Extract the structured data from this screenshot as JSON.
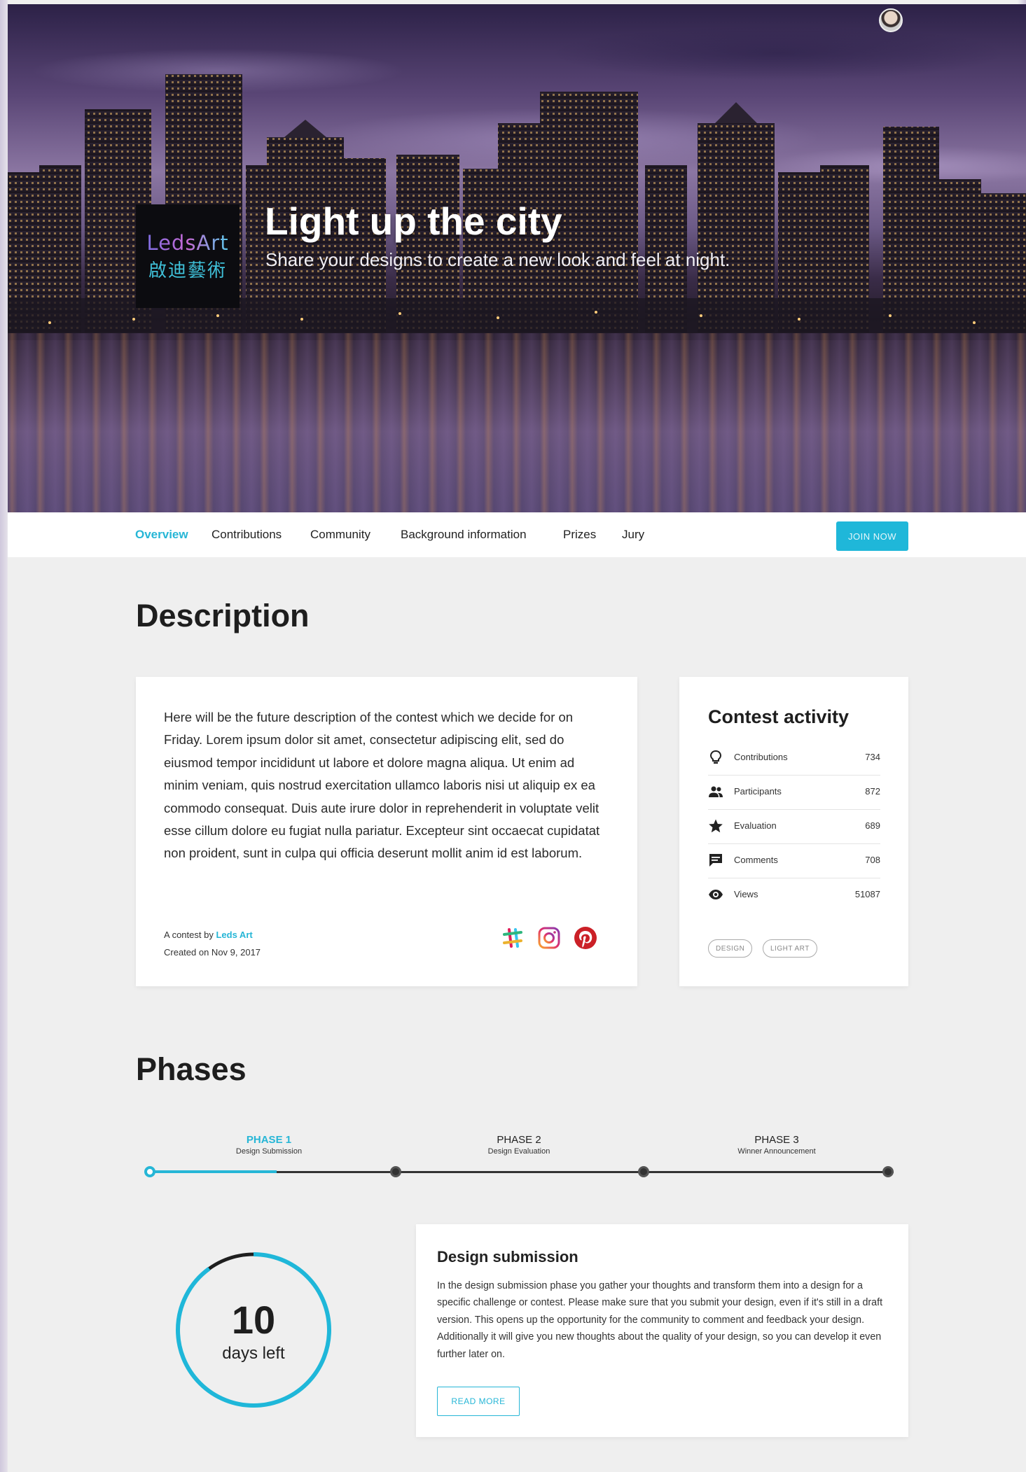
{
  "hero": {
    "title": "Light up the city",
    "subtitle": "Share your designs to create a new look and feel at night.",
    "logo_line1": "LedsArt",
    "logo_line2": "啟迪藝術"
  },
  "nav": {
    "tabs": [
      "Overview",
      "Contributions",
      "Community",
      "Background information",
      "Prizes",
      "Jury"
    ],
    "active_tab": "Overview",
    "join_label": "JOIN NOW"
  },
  "description": {
    "heading": "Description",
    "body": "Here will be the future description of the contest which we decide for on Friday. Lorem ipsum dolor sit amet, consectetur adipiscing elit, sed do eiusmod tempor incididunt ut labore et dolore magna aliqua. Ut enim ad minim veniam, quis nostrud exercitation ullamco laboris nisi ut aliquip ex ea commodo consequat. Duis aute irure dolor in reprehenderit in voluptate velit esse cillum dolore eu fugiat nulla pariatur. Excepteur sint occaecat cupidatat non proident, sunt in culpa qui officia deserunt mollit anim id est laborum.",
    "by_prefix": "A contest by",
    "by_name": "Leds Art",
    "created": "Created on Nov 9, 2017",
    "social_icons": [
      "slack-icon",
      "instagram-icon",
      "pinterest-icon"
    ]
  },
  "activity": {
    "title": "Contest activity",
    "rows": [
      {
        "icon": "lightbulb-icon",
        "label": "Contributions",
        "value": "734"
      },
      {
        "icon": "people-icon",
        "label": "Participants",
        "value": "872"
      },
      {
        "icon": "star-icon",
        "label": "Evaluation",
        "value": "689"
      },
      {
        "icon": "comment-icon",
        "label": "Comments",
        "value": "708"
      },
      {
        "icon": "eye-icon",
        "label": "Views",
        "value": "51087"
      }
    ],
    "tags": [
      "DESIGN",
      "LIGHT ART"
    ]
  },
  "phases": {
    "heading": "Phases",
    "items": [
      {
        "name": "PHASE 1",
        "sub": "Design Submission"
      },
      {
        "name": "PHASE 2",
        "sub": "Design Evaluation"
      },
      {
        "name": "PHASE 3",
        "sub": "Winner Announcement"
      }
    ],
    "active_index": 0,
    "progress_fraction": 0.17,
    "countdown_value": "10",
    "countdown_unit": "days left",
    "countdown_fraction": 0.9
  },
  "submission": {
    "title": "Design submission",
    "body": "In the design submission phase you gather your thoughts and transform them into a design for a specific challenge or contest. Please make sure that you submit your design, even if it's still in a draft version. This opens up the opportunity for the community to comment and feedback your design. Additionally it will give you new thoughts about the quality of your design, so you can develop it even further later on.",
    "read_more": "READ MORE"
  },
  "colors": {
    "accent": "#1fb7d9",
    "dark": "#1e1e1e",
    "background": "#efefef"
  }
}
